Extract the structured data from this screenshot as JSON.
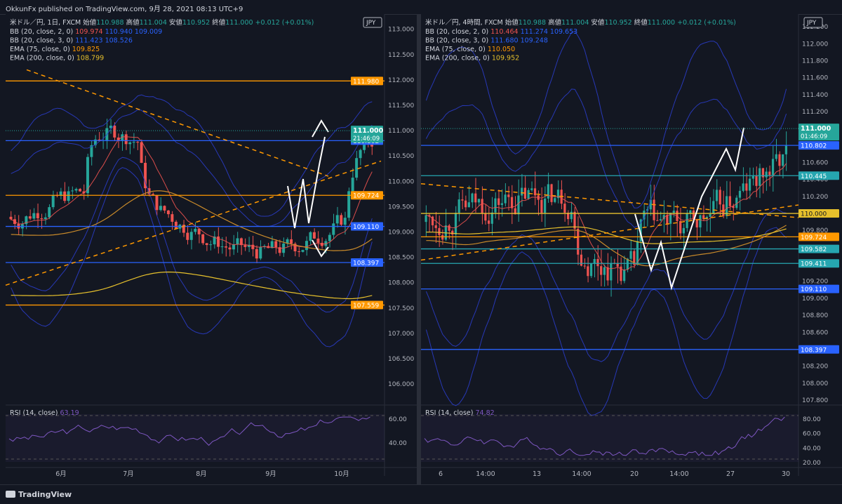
{
  "header": {
    "publish": "OkkunFx published on TradingView.com, 9月 28, 2021 08:13 UTC+9"
  },
  "footer": {
    "brand": "TradingView"
  },
  "colors": {
    "bg": "#131722",
    "blue": "#2962ff",
    "orange": "#ff9800",
    "up": "#26a69a",
    "down": "#ef5350",
    "bb": "#2a3cc7",
    "ema75": "#c98a2a",
    "ema200": "#e6c02c",
    "rsi": "#7e57c2",
    "cyan": "#26a6b0"
  },
  "chart_data": [
    {
      "type": "candlestick",
      "panel": "left",
      "title": "米ドル／円, 1日, FXCM",
      "ohlc_header": {
        "open_label": "始値",
        "open": "110.988",
        "high_label": "高値",
        "high": "111.004",
        "low_label": "安値",
        "low": "110.952",
        "close_label": "終値",
        "close": "111.000",
        "change": "+0.012 (+0.01%)"
      },
      "indicators": [
        {
          "name": "BB (20, close, 2, 0)",
          "values": [
            "109.974",
            "110.940",
            "109.009"
          ],
          "colors": [
            "#ef5350",
            "#2962ff",
            "#2962ff"
          ]
        },
        {
          "name": "BB (20, close, 3, 0)",
          "values": [
            "111.423",
            "108.526"
          ],
          "colors": [
            "#2962ff",
            "#2962ff"
          ]
        },
        {
          "name": "EMA (75, close, 0)",
          "values": [
            "109.825"
          ],
          "colors": [
            "#ff9800"
          ]
        },
        {
          "name": "EMA (200, close, 0)",
          "values": [
            "108.799"
          ],
          "colors": [
            "#e6c02c"
          ]
        }
      ],
      "currency": "JPY",
      "ylim": [
        105.6,
        113.3
      ],
      "yticks": [
        "113.000",
        "112.500",
        "112.000",
        "111.500",
        "111.000",
        "110.500",
        "110.000",
        "109.500",
        "109.000",
        "108.500",
        "108.000",
        "107.500",
        "107.000",
        "106.500",
        "106.000"
      ],
      "ytick_values": [
        113.0,
        112.5,
        112.0,
        111.5,
        111.0,
        110.5,
        110.0,
        109.5,
        109.0,
        108.5,
        108.0,
        107.5,
        107.0,
        106.5,
        106.0
      ],
      "xticks": [
        "6月",
        "7月",
        "8月",
        "9月",
        "10月"
      ],
      "price_lines": [
        {
          "label": "111.980",
          "value": 111.98,
          "color": "#ff9800"
        },
        {
          "label": "110.802",
          "value": 110.802,
          "color": "#2962ff"
        },
        {
          "label": "109.724",
          "value": 109.724,
          "color": "#ff9800"
        },
        {
          "label": "109.110",
          "value": 109.11,
          "color": "#2962ff"
        },
        {
          "label": "108.397",
          "value": 108.397,
          "color": "#2962ff"
        },
        {
          "label": "107.559",
          "value": 107.559,
          "color": "#ff9800"
        }
      ],
      "current": {
        "label": "111.000",
        "countdown": "21:46:09",
        "value": 111.0
      },
      "rsi": {
        "label": "RSI (14, close)",
        "value": "63.19",
        "yticks": [
          "60.00",
          "40.00"
        ]
      }
    },
    {
      "type": "candlestick",
      "panel": "right",
      "title": "米ドル／円, 4時間, FXCM",
      "ohlc_header": {
        "open_label": "始値",
        "open": "110.988",
        "high_label": "高値",
        "high": "111.004",
        "low_label": "安値",
        "low": "110.952",
        "close_label": "終値",
        "close": "111.000",
        "change": "+0.012 (+0.01%)"
      },
      "indicators": [
        {
          "name": "BB (20, close, 2, 0)",
          "values": [
            "110.464",
            "111.274",
            "109.653"
          ],
          "colors": [
            "#ef5350",
            "#2962ff",
            "#2962ff"
          ]
        },
        {
          "name": "BB (20, close, 3, 0)",
          "values": [
            "111.680",
            "109.248"
          ],
          "colors": [
            "#2962ff",
            "#2962ff"
          ]
        },
        {
          "name": "EMA (75, close, 0)",
          "values": [
            "110.050"
          ],
          "colors": [
            "#ff9800"
          ]
        },
        {
          "name": "EMA (200, close, 0)",
          "values": [
            "109.952"
          ],
          "colors": [
            "#e6c02c"
          ]
        }
      ],
      "currency": "JPY",
      "ylim": [
        107.75,
        112.35
      ],
      "yticks": [
        "112.200",
        "112.000",
        "111.800",
        "111.600",
        "111.400",
        "111.200",
        "110.600",
        "110.400",
        "110.200",
        "109.800",
        "109.200",
        "109.000",
        "108.800",
        "108.600",
        "108.200",
        "108.000",
        "107.800"
      ],
      "ytick_values": [
        112.2,
        112.0,
        111.8,
        111.6,
        111.4,
        111.2,
        110.6,
        110.4,
        110.2,
        109.8,
        109.2,
        109.0,
        108.8,
        108.6,
        108.2,
        108.0,
        107.8
      ],
      "xticks": [
        "6",
        "14:00",
        "13",
        "14:00",
        "20",
        "14:00",
        "27",
        "30"
      ],
      "price_lines": [
        {
          "label": "110.802",
          "value": 110.802,
          "color": "#2962ff"
        },
        {
          "label": "110.445",
          "value": 110.445,
          "color": "#26a6b0"
        },
        {
          "label": "110.000",
          "value": 110.0,
          "color": "#e6c02c"
        },
        {
          "label": "109.724",
          "value": 109.724,
          "color": "#ff9800"
        },
        {
          "label": "109.582",
          "value": 109.582,
          "color": "#26a6b0"
        },
        {
          "label": "109.411",
          "value": 109.411,
          "color": "#26a6b0"
        },
        {
          "label": "109.110",
          "value": 109.11,
          "color": "#2962ff"
        },
        {
          "label": "108.397",
          "value": 108.397,
          "color": "#2962ff"
        }
      ],
      "current": {
        "label": "111.000",
        "countdown": "01:46:09",
        "value": 111.0
      },
      "rsi": {
        "label": "RSI (14, close)",
        "value": "74.82",
        "yticks": [
          "80.00",
          "60.00",
          "40.00",
          "20.00"
        ]
      }
    }
  ]
}
